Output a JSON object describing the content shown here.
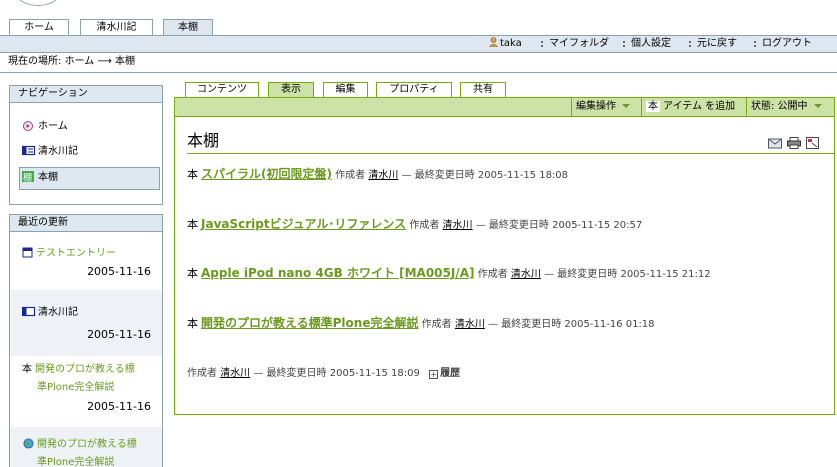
{
  "portal_tabs": [
    "ホーム",
    "清水川記",
    "本棚"
  ],
  "personal_bar": {
    "user": "taka",
    "items": [
      "マイフォルダ",
      "個人設定",
      "元に戻す",
      "ログアウト"
    ]
  },
  "breadcrumb": {
    "prefix": "現在の場所:",
    "home": "ホーム",
    "arrow": "⟶",
    "current": "本棚"
  },
  "navigation": {
    "title": "ナビゲーション",
    "items": [
      {
        "label": "ホーム",
        "icon": "home-icon"
      },
      {
        "label": "清水川記",
        "icon": "weblog-icon"
      },
      {
        "label": "本棚",
        "icon": "bookshelf-icon"
      }
    ]
  },
  "recent": {
    "title": "最近の更新",
    "items": [
      {
        "title": "テストエントリー",
        "title_line2": "",
        "date": "2005-11-16",
        "icon": "entry-icon"
      },
      {
        "title": "清水川記",
        "title_line2": "",
        "date": "2005-11-16",
        "icon": "weblog-icon"
      },
      {
        "title": "開発のプロが教える標",
        "title_line2": "準Plone完全解説",
        "date": "2005-11-16",
        "icon": "book-kanji"
      },
      {
        "title": "開発のプロが教える標",
        "title_line2": "準Plone完全解説",
        "date": "",
        "icon": "globe-icon"
      }
    ]
  },
  "content_tabs": [
    "コンテンツ",
    "表示",
    "編集",
    "プロパティ",
    "共有"
  ],
  "action_bar": {
    "edit_ops": "編集操作",
    "add_kanji": "本",
    "add_item": "アイテム を追加",
    "state": "状態: 公開中"
  },
  "document": {
    "title": "本棚",
    "entries": [
      {
        "kanji": "本",
        "title": "スパイラル(初回限定盤)",
        "author_label": "作成者",
        "author": "清水川",
        "modified_label": "— 最終変更日時",
        "modified": "2005-11-15 18:08"
      },
      {
        "kanji": "本",
        "title": "JavaScriptビジュアル･リファレンス",
        "author_label": "作成者",
        "author": "清水川",
        "modified_label": "— 最終変更日時",
        "modified": "2005-11-15 20:57"
      },
      {
        "kanji": "本",
        "title": "Apple iPod nano 4GB ホワイト [MA005J/A]",
        "author_label": "作成者",
        "author": "清水川",
        "modified_label": "— 最終変更日時",
        "modified": "2005-11-15 21:12"
      },
      {
        "kanji": "本",
        "title": "開発のプロが教える標準Plone完全解説",
        "author_label": "作成者",
        "author": "清水川",
        "modified_label": "— 最終変更日時",
        "modified": "2005-11-16 01:18"
      }
    ],
    "byline": {
      "author_label": "作成者",
      "author": "清水川",
      "modified_label": "— 最終変更日時",
      "modified": "2005-11-15 18:09",
      "history": "履歴"
    }
  },
  "colors": {
    "plone_blue": "#dee7ef",
    "border_blue": "#8ca0b3",
    "green": "#74ae0b",
    "green_light": "#cde2a7",
    "link_green": "#6b9a1e"
  }
}
